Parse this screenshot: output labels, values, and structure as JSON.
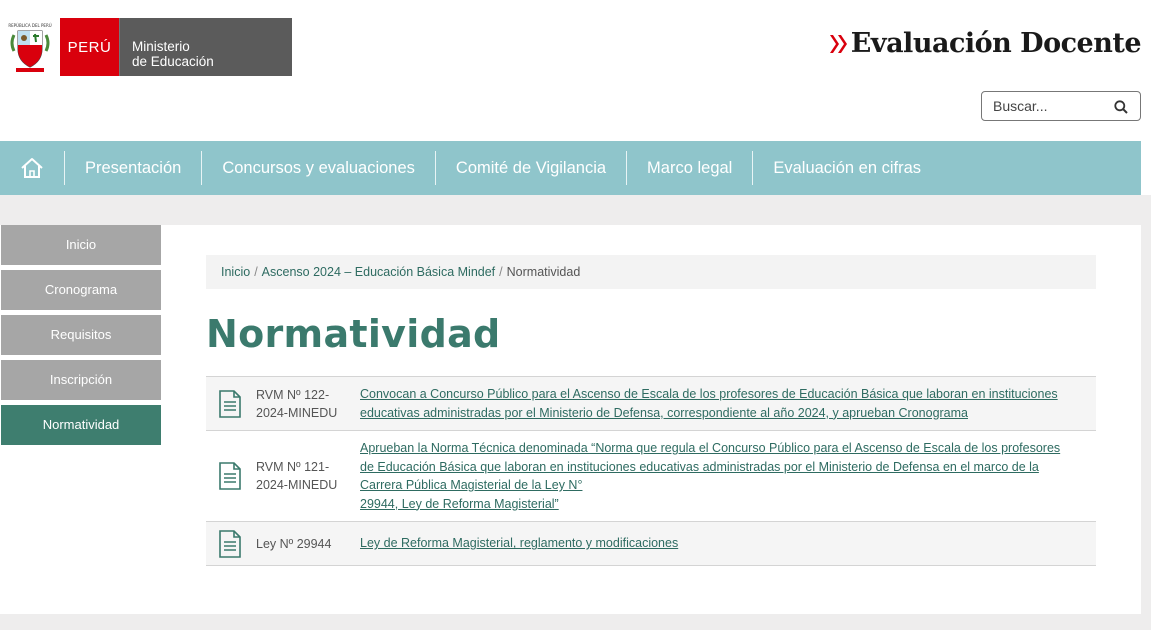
{
  "header": {
    "logo_peru": "PERÚ",
    "logo_ministry_line1": "Ministerio",
    "logo_ministry_line2": "de Educación",
    "brand_title": "Evaluación Docente",
    "brand_chevron_color": "#d9000d"
  },
  "search": {
    "placeholder": "Buscar..."
  },
  "nav": {
    "items": [
      {
        "label": "Presentación"
      },
      {
        "label": "Concursos y evaluaciones"
      },
      {
        "label": "Comité de Vigilancia"
      },
      {
        "label": "Marco legal"
      },
      {
        "label": "Evaluación en cifras"
      }
    ]
  },
  "sidebar": {
    "items": [
      {
        "label": "Inicio"
      },
      {
        "label": "Cronograma"
      },
      {
        "label": "Requisitos"
      },
      {
        "label": "Inscripción"
      },
      {
        "label": "Normatividad",
        "active": true
      }
    ]
  },
  "breadcrumb": {
    "home": "Inicio",
    "sep": "/",
    "section": "Ascenso 2024 – Educación Básica Mindef",
    "current": "Normatividad"
  },
  "page_title": "Normatividad",
  "documents": [
    {
      "code_line1": "RVM Nº 122-",
      "code_line2": "2024-MINEDU",
      "desc_lines": [
        "Convocan a Concurso Público para el Ascenso de Escala de los profesores de Educación Básica que laboran en instituciones",
        "educativas administradas por el Ministerio de Defensa, correspondiente al año 2024, y aprueban Cronograma"
      ]
    },
    {
      "code_line1": "RVM Nº 121-",
      "code_line2": "2024-MINEDU",
      "desc_lines": [
        "Aprueban la Norma Técnica denominada “Norma que regula el Concurso Público para el Ascenso de Escala de los profesores",
        "de Educación Básica que laboran en instituciones educativas administradas por el Ministerio de Defensa en el marco de la",
        "Carrera Pública Magisterial de la Ley N°",
        "29944, Ley de Reforma Magisterial”"
      ]
    },
    {
      "code_line1": "Ley Nº 29944",
      "code_line2": "",
      "desc_lines": [
        "Ley de Reforma Magisterial, reglamento y modificaciones"
      ]
    }
  ],
  "colors": {
    "nav_bg": "#8fc5cb",
    "accent_green": "#3b7a6d",
    "sidebar_active": "#3e7e6f",
    "sidebar_inactive": "#a6a6a6",
    "peru_red": "#d9000d"
  }
}
